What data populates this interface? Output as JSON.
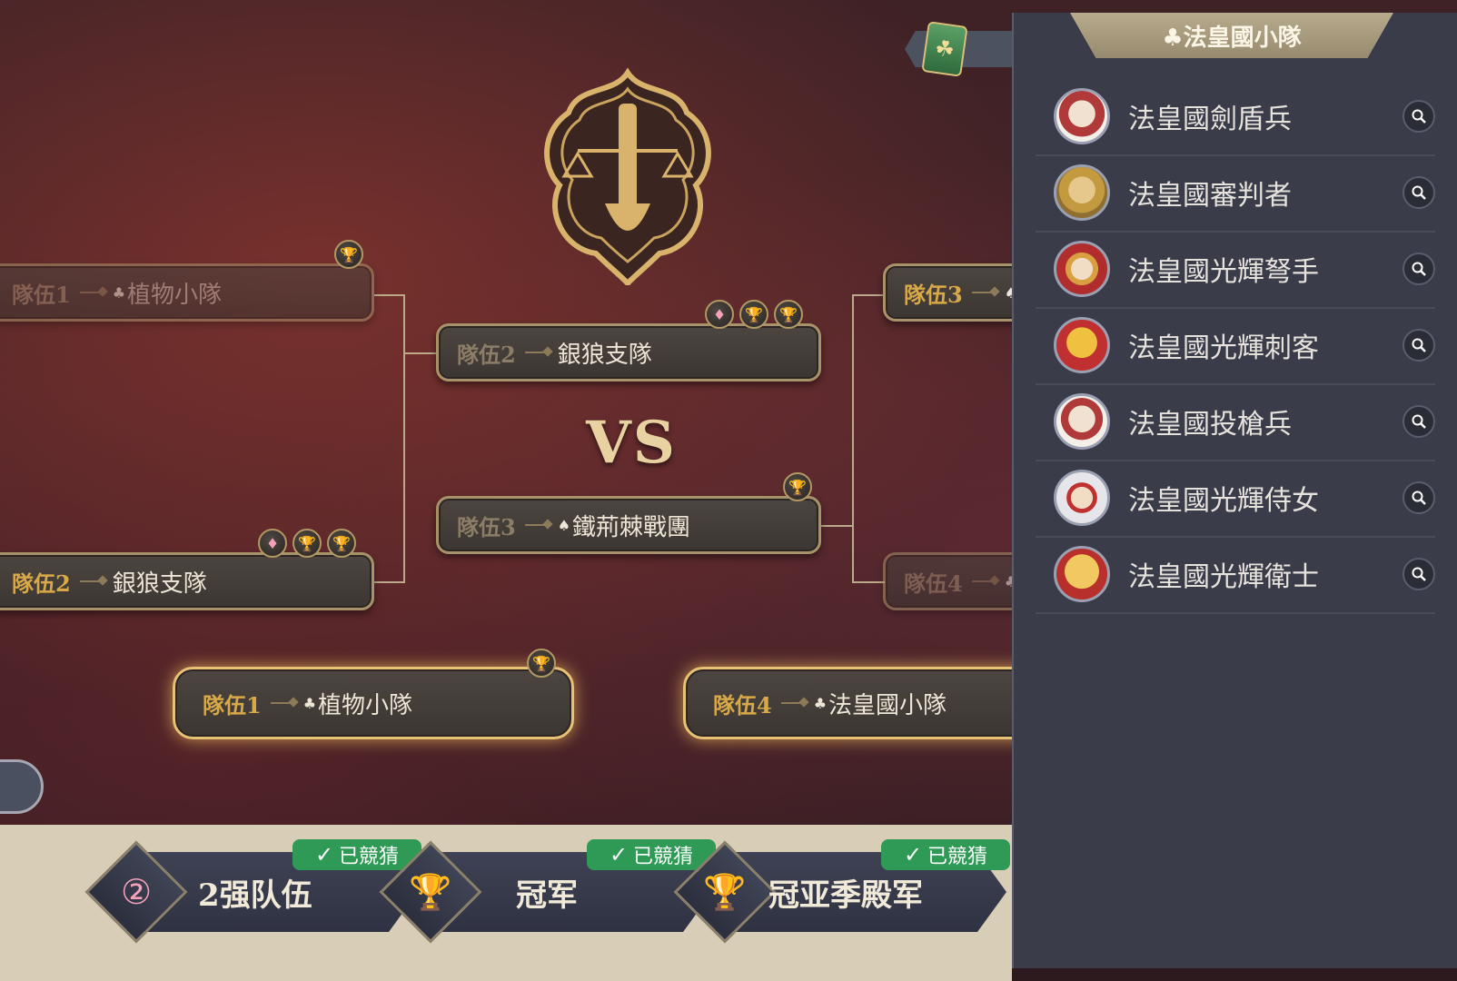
{
  "bracket": {
    "left_top": {
      "label": "隊伍1",
      "suit": "♣",
      "name": "植物小隊"
    },
    "left_bottom": {
      "label": "隊伍2",
      "name": "銀狼支隊"
    },
    "center_top": {
      "label": "隊伍2",
      "name": "銀狼支隊"
    },
    "vs": "VS",
    "center_bottom": {
      "label": "隊伍3",
      "suit": "♠",
      "name": "鐵荊棘戰團"
    },
    "right_top": {
      "label": "隊伍3",
      "suit": "♠"
    },
    "right_bottom": {
      "label": "隊伍4",
      "suit": "♣"
    },
    "final_left": {
      "label": "隊伍1",
      "suit": "♣",
      "name": "植物小隊"
    },
    "final_right": {
      "label": "隊伍4",
      "suit": "♣",
      "name": "法皇國小隊"
    }
  },
  "panel": {
    "title": "♣法皇國小隊",
    "units": [
      {
        "name": "法皇國劍盾兵"
      },
      {
        "name": "法皇國審判者"
      },
      {
        "name": "法皇國光輝弩手"
      },
      {
        "name": "法皇國光輝刺客"
      },
      {
        "name": "法皇國投槍兵"
      },
      {
        "name": "法皇國光輝侍女"
      },
      {
        "name": "法皇國光輝衛士"
      }
    ]
  },
  "guesses": [
    {
      "label": "2强队伍",
      "status": "已競猜",
      "icon": "rank-2-icon"
    },
    {
      "label": "冠军",
      "status": "已競猜",
      "icon": "trophy-icon"
    },
    {
      "label": "冠亚季殿军",
      "status": "已競猜",
      "icon": "trophy-icon"
    }
  ],
  "colors": {
    "accent_gold": "#d9a948",
    "guessed_green": "#2f9a55",
    "panel_bg": "#3a3c4a"
  }
}
